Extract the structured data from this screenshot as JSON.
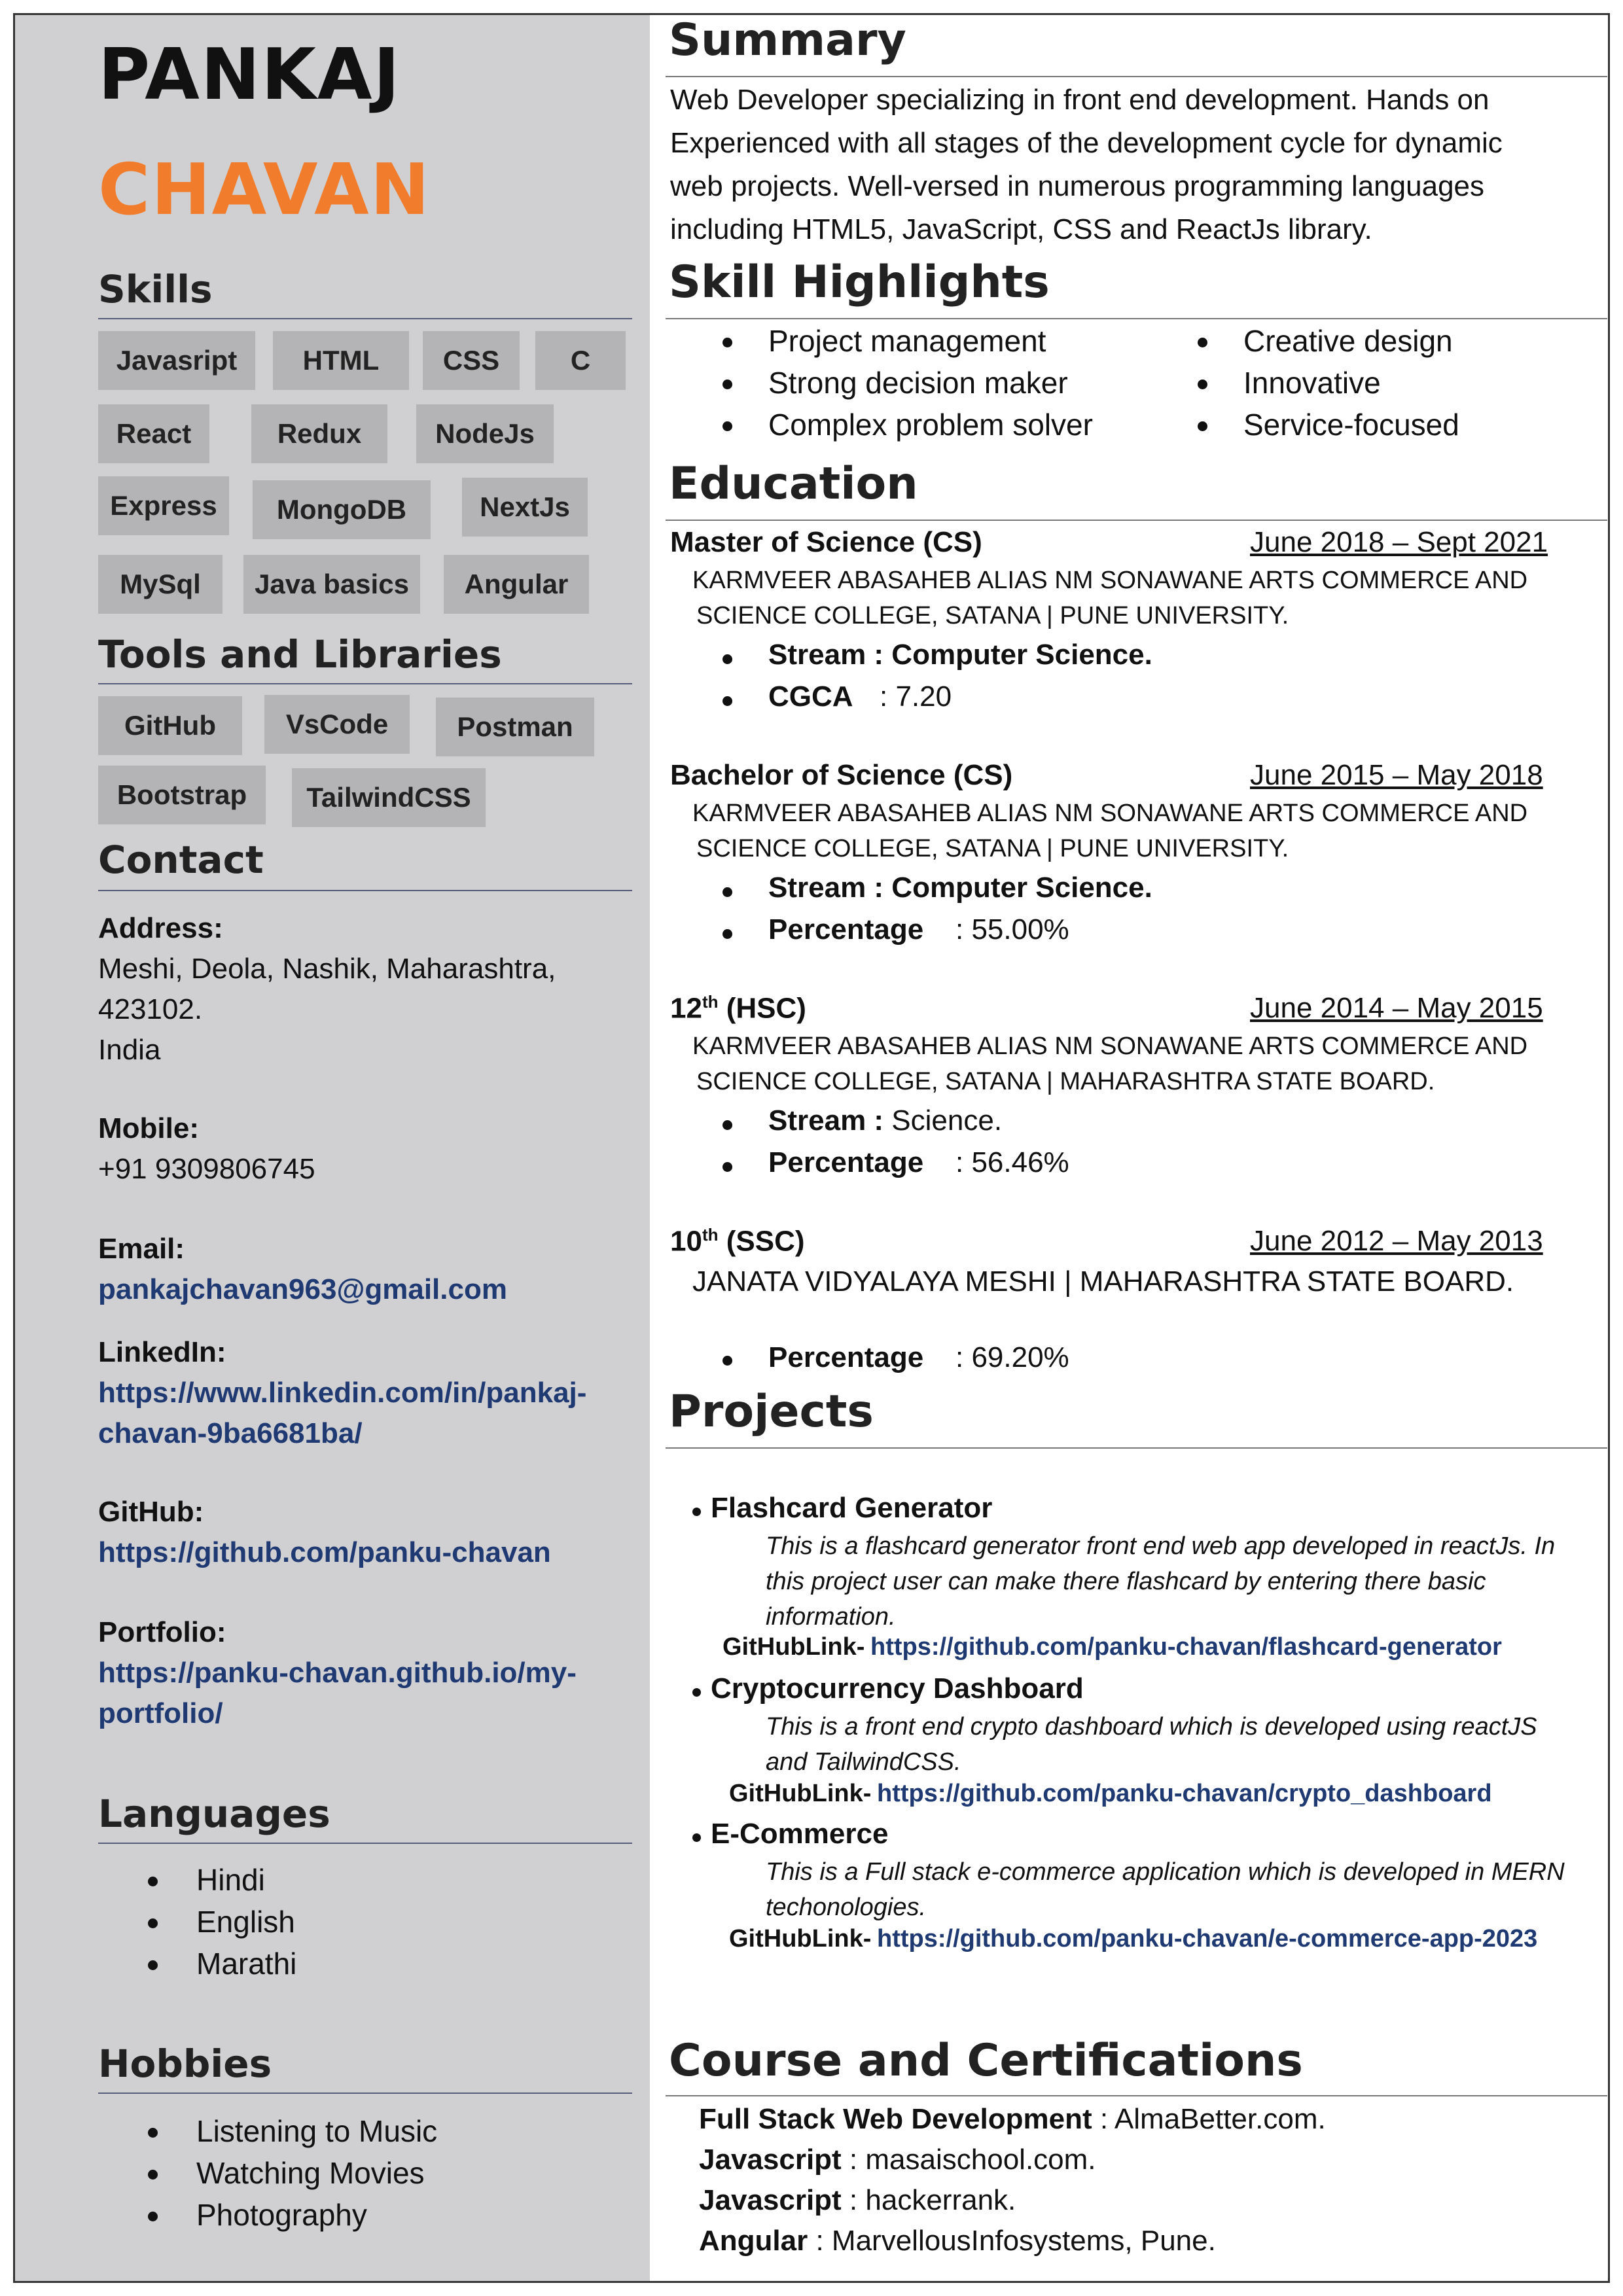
{
  "name": {
    "first": "PANKAJ",
    "last": "CHAVAN"
  },
  "accent_color": "#f07c2c",
  "sidebar": {
    "skills_title": "Skills",
    "skills": [
      "Javasript",
      "HTML",
      "CSS",
      "C",
      "React",
      "Redux",
      "NodeJs",
      "Express",
      "MongoDB",
      "NextJs",
      "MySql",
      "Java basics",
      "Angular"
    ],
    "tools_title": "Tools and Libraries",
    "tools": [
      "GitHub",
      "VsCode",
      "Postman",
      "Bootstrap",
      "TailwindCSS"
    ],
    "contact_title": "Contact",
    "address_label": "Address:",
    "address_lines": [
      "Meshi, Deola, Nashik, Maharashtra,",
      "423102.",
      "India"
    ],
    "mobile_label": "Mobile:",
    "mobile": "+91 9309806745",
    "email_label": "Email:",
    "email": "pankajchavan963@gmail.com",
    "linkedin_label": "LinkedIn:",
    "linkedin_lines": [
      "https://www.linkedin.com/in/pankaj-",
      "chavan-9ba6681ba/"
    ],
    "github_label": "GitHub:",
    "github": "https://github.com/panku-chavan",
    "portfolio_label": "Portfolio:",
    "portfolio_lines": [
      "https://panku-chavan.github.io/my-",
      "portfolio/"
    ],
    "languages_title": "Languages",
    "languages": [
      "Hindi",
      "English",
      "Marathi"
    ],
    "hobbies_title": "Hobbies",
    "hobbies": [
      "Listening to Music",
      "Watching Movies",
      "Photography"
    ]
  },
  "main": {
    "summary_title": "Summary",
    "summary_lines": [
      "Web Developer specializing in front end development. Hands on",
      "Experienced with all stages of the development cycle for dynamic",
      "web projects. Well-versed in numerous programming languages",
      "including HTML5, JavaScript, CSS and ReactJs library."
    ],
    "highlights_title": "Skill Highlights",
    "highlights_left": [
      "Project management",
      "Strong decision maker",
      "Complex problem solver"
    ],
    "highlights_right": [
      "Creative design",
      "Innovative",
      "Service-focused"
    ],
    "education_title": "Education",
    "education": [
      {
        "degree": "Master of Science (CS)",
        "sup": "",
        "date": "June 2018 – Sept 2021",
        "inst_lines": [
          "KARMVEER ABASAHEB ALIAS NM SONAWANE ARTS COMMERCE AND",
          "SCIENCE COLLEGE, SATANA | PUNE UNIVERSITY."
        ],
        "k1": "Stream  : Computer Science.",
        "k2": "CGCA",
        "v2": ": 7.20"
      },
      {
        "degree": "Bachelor of Science (CS)",
        "sup": "",
        "date": "June 2015 – May 2018",
        "inst_lines": [
          "KARMVEER ABASAHEB ALIAS NM SONAWANE ARTS COMMERCE AND",
          "SCIENCE COLLEGE, SATANA | PUNE UNIVERSITY."
        ],
        "k1": "Stream  : Computer Science.",
        "k2": "Percentage",
        "v2": ": 55.00%"
      },
      {
        "degree": "12",
        "sup": "th",
        "degree_rest": " (HSC)",
        "date": "June 2014 – May 2015",
        "inst_lines": [
          "KARMVEER ABASAHEB ALIAS NM SONAWANE ARTS COMMERCE AND",
          "SCIENCE COLLEGE, SATANA | MAHARASHTRA STATE BOARD."
        ],
        "k1": "Stream  :",
        "k1v": " Science.",
        "k2": "Percentage",
        "v2": ": 56.46%"
      },
      {
        "degree": "10",
        "sup": "th",
        "degree_rest": " (SSC)",
        "date": "June 2012 – May 2013",
        "inst_lines": [
          "JANATA VIDYALAYA MESHI | MAHARASHTRA STATE BOARD."
        ],
        "k2": "Percentage",
        "v2": ": 69.20%"
      }
    ],
    "projects_title": "Projects",
    "projects": [
      {
        "title": "Flashcard Generator",
        "desc_lines": [
          "This is a flashcard generator front end web app developed in reactJs. In",
          "this project user can make there flashcard by entering there basic",
          "information."
        ],
        "gh_label": "GitHubLink-",
        "gh_link": "https://github.com/panku-chavan/flashcard-generator"
      },
      {
        "title": "Cryptocurrency Dashboard",
        "desc_lines": [
          "This is a front end crypto dashboard which is developed using reactJS",
          "and TailwindCSS."
        ],
        "gh_label": "GitHubLink-",
        "gh_link": "https://github.com/panku-chavan/crypto_dashboard"
      },
      {
        "title": "E-Commerce",
        "desc_lines": [
          "This is a Full stack e-commerce application which is developed in MERN",
          "techonologies."
        ],
        "gh_label": "GitHubLink-",
        "gh_link": "https://github.com/panku-chavan/e-commerce-app-2023"
      }
    ],
    "certs_title": "Course and Certifications",
    "certs": [
      {
        "name": "Full Stack Web Development",
        "sep": " : ",
        "org": "AlmaBetter.com."
      },
      {
        "name": "Javascript",
        "sep": " : ",
        "org": "masaischool.com."
      },
      {
        "name": "Javascript",
        "sep": " : ",
        "org": "hackerrank."
      },
      {
        "name": "Angular",
        "sep": " : ",
        "org": "MarvellousInfosystems, Pune."
      }
    ]
  }
}
